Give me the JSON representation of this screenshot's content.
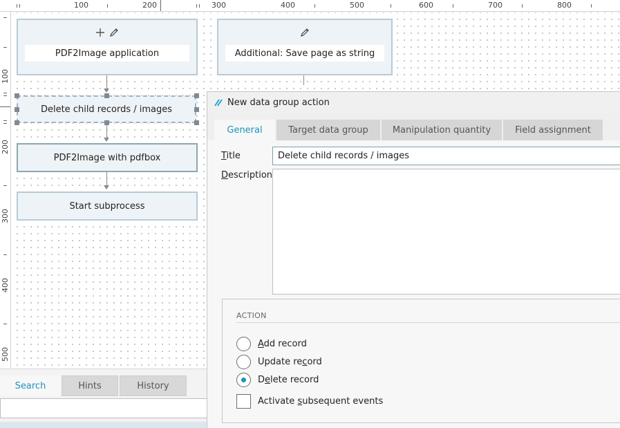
{
  "ruler": {
    "top_labels": [
      "100",
      "200",
      "300",
      "400",
      "500",
      "600",
      "700",
      "800"
    ],
    "left_labels": [
      "100",
      "200",
      "300",
      "400",
      "500"
    ]
  },
  "canvas": {
    "nodes": {
      "pdf2image_app": "PDF2Image application",
      "additional_save": "Additional: Save page as string",
      "delete_child": "Delete child records / images",
      "pdf2image_pdfbox": "PDF2Image with pdfbox",
      "start_subprocess": "Start subprocess"
    }
  },
  "bottom_panel": {
    "tabs": [
      "Search",
      "Hints",
      "History"
    ],
    "active_tab": "Search",
    "search_value": ""
  },
  "dialog": {
    "title": "New data group action",
    "tabs": [
      "General",
      "Target data group",
      "Manipulation quantity",
      "Field assignment"
    ],
    "active_tab": "General",
    "title_label": {
      "mnemonic": "T",
      "rest": "itle"
    },
    "description_label": {
      "mnemonic": "D",
      "rest": "escription"
    },
    "title_value": "Delete child records / images",
    "description_value": "",
    "action_section": "ACTION",
    "options": {
      "add": {
        "pre": "",
        "mnemonic": "A",
        "post": "dd record"
      },
      "update": {
        "pre": "Update re",
        "mnemonic": "c",
        "post": "ord"
      },
      "delete": {
        "pre": "D",
        "mnemonic": "e",
        "post": "lete record"
      }
    },
    "selected_option": "Delete record",
    "activate_events": {
      "pre": "Activate ",
      "mnemonic": "s",
      "post": "ubsequent events"
    },
    "activate_events_checked": false
  },
  "colors": {
    "accent": "#1c93b9",
    "node_fill": "#eef3f7",
    "node_border": "#b7cad7"
  }
}
